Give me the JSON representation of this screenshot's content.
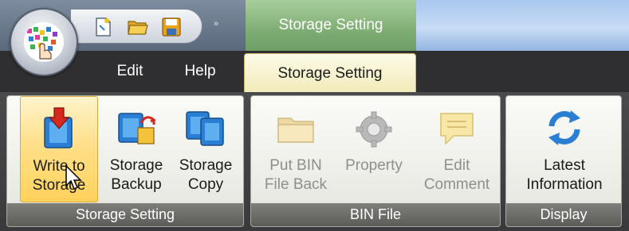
{
  "contextual_tab_header": "Storage Setting",
  "quick_access": {
    "icons": [
      "new-document-icon",
      "open-folder-icon",
      "save-icon"
    ],
    "overflow_glyph": "»"
  },
  "tabs": {
    "edit": "Edit",
    "help": "Help",
    "storage_setting": "Storage Setting"
  },
  "groups": {
    "storage_setting": {
      "label": "Storage Setting",
      "buttons": [
        {
          "line1": "Write to",
          "line2": "Storage",
          "icon": "write-to-storage-icon",
          "state": "hover"
        },
        {
          "line1": "Storage",
          "line2": "Backup",
          "icon": "storage-backup-icon",
          "state": "normal"
        },
        {
          "line1": "Storage",
          "line2": "Copy",
          "icon": "storage-copy-icon",
          "state": "normal"
        }
      ]
    },
    "bin_file": {
      "label": "BIN File",
      "buttons": [
        {
          "line1": "Put BIN",
          "line2": "File Back",
          "icon": "folder-icon",
          "state": "disabled"
        },
        {
          "line1": "Property",
          "line2": "",
          "icon": "gear-icon",
          "state": "disabled"
        },
        {
          "line1": "Edit",
          "line2": "Comment",
          "icon": "comment-icon",
          "state": "disabled"
        }
      ]
    },
    "display": {
      "label": "Display",
      "buttons": [
        {
          "line1": "Latest",
          "line2": "Information",
          "icon": "refresh-icon",
          "state": "normal"
        }
      ]
    }
  },
  "colors": {
    "active_tab": "#f1eab8",
    "context_header": "#7fae74",
    "hover_highlight": "#ffd25c",
    "accent_blue": "#2a7fd4",
    "accent_red": "#d6281c"
  }
}
